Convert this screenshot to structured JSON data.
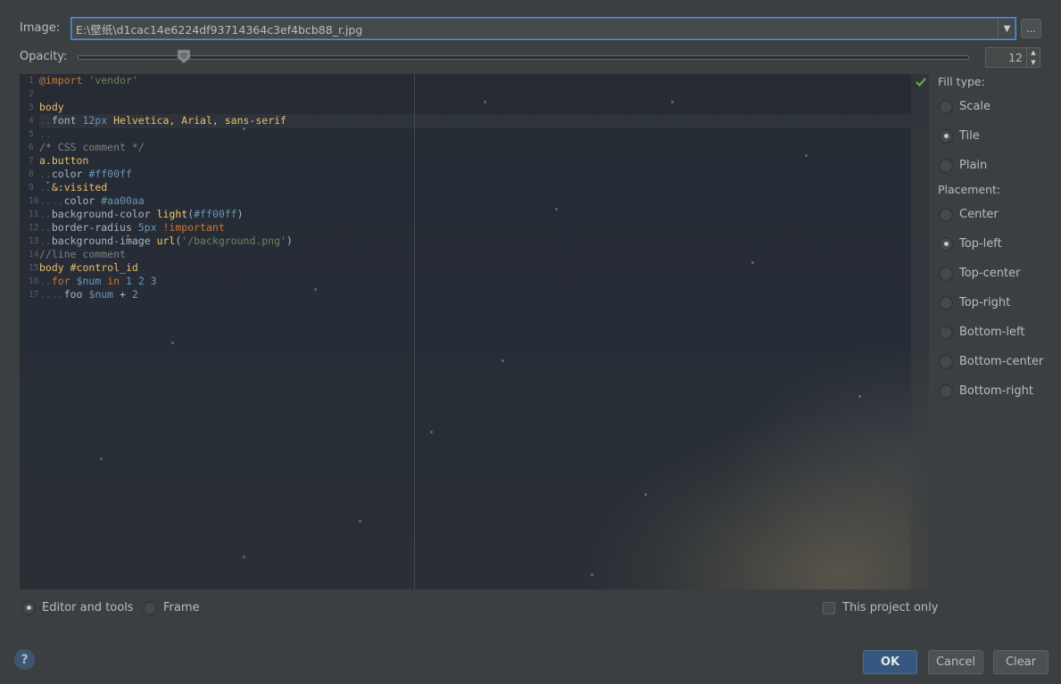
{
  "image": {
    "label": "Image:",
    "path": "E:\\壁纸\\d1cac14e6224df93714364c3ef4bcb88_r.jpg",
    "dropdown_icon": "chevron-down-icon",
    "browse_label": "..."
  },
  "opacity": {
    "label": "Opacity:",
    "value": "12",
    "level": 0.12
  },
  "code_lines": [
    {
      "n": "1",
      "html": "<span class='kw'>@import</span> <span class='str'>'vendor'</span>"
    },
    {
      "n": "2",
      "html": ""
    },
    {
      "n": "3",
      "html": "<span class='sel'>body</span>"
    },
    {
      "n": "4",
      "html": "<span class='dot'>..</span><span class='txt'>font </span><span class='num'>12px</span><span class='sel'> Helvetica, Arial, sans-serif</span>"
    },
    {
      "n": "5",
      "html": "<span class='dot'>..</span>"
    },
    {
      "n": "6",
      "html": "<span class='cmt'>/* CSS comment */</span>"
    },
    {
      "n": "7",
      "html": "<span class='sel'>a.button</span>"
    },
    {
      "n": "8",
      "html": "<span class='dot'>..</span><span class='txt'>color </span><span class='num'>#ff00ff</span>"
    },
    {
      "n": "9",
      "html": "<span class='dot'>..</span><span class='sel'>&amp;:visited</span>"
    },
    {
      "n": "10",
      "html": "<span class='dot'>....</span><span class='txt'>color </span><span class='num'>#aa00aa</span>"
    },
    {
      "n": "11",
      "html": "<span class='dot'>..</span><span class='txt'>background-color </span><span class='fn'>light</span><span class='txt'>(</span><span class='num'>#ff00ff</span><span class='txt'>)</span>"
    },
    {
      "n": "12",
      "html": "<span class='dot'>..</span><span class='txt'>border-radius </span><span class='num'>5px</span><span class='kw'> !important</span>"
    },
    {
      "n": "13",
      "html": "<span class='dot'>..</span><span class='txt'>background-image </span><span class='fn'>url</span><span class='txt'>(</span><span class='str'>'/background.png'</span><span class='txt'>)</span>"
    },
    {
      "n": "14",
      "html": "<span class='cmt'>//line comment</span>"
    },
    {
      "n": "15",
      "html": "<span class='sel'>body</span><span class='sel'> #control_id</span>"
    },
    {
      "n": "16",
      "html": "<span class='dot'>..</span><span class='kw'>for</span><span class='num'> $num</span><span class='kw'> in</span><span class='num'> 1 2 3</span>"
    },
    {
      "n": "17",
      "html": "<span class='dot'>....</span><span class='txt'>foo </span><span class='num'>$num</span><span class='txt'> + </span><span class='num'>2</span>"
    }
  ],
  "fill_type": {
    "label": "Fill type:",
    "options": [
      {
        "label": "Scale",
        "selected": false
      },
      {
        "label": "Tile",
        "selected": true
      },
      {
        "label": "Plain",
        "selected": false
      }
    ]
  },
  "placement": {
    "label": "Placement:",
    "options": [
      {
        "label": "Center",
        "selected": false
      },
      {
        "label": "Top-left",
        "selected": true
      },
      {
        "label": "Top-center",
        "selected": false
      },
      {
        "label": "Top-right",
        "selected": false
      },
      {
        "label": "Bottom-left",
        "selected": false
      },
      {
        "label": "Bottom-center",
        "selected": false
      },
      {
        "label": "Bottom-right",
        "selected": false
      }
    ]
  },
  "target": {
    "editor_and_tools": "Editor and tools",
    "frame": "Frame",
    "this_project_only": "This project only"
  },
  "buttons": {
    "ok": "OK",
    "cancel": "Cancel",
    "clear": "Clear",
    "help": "?"
  }
}
